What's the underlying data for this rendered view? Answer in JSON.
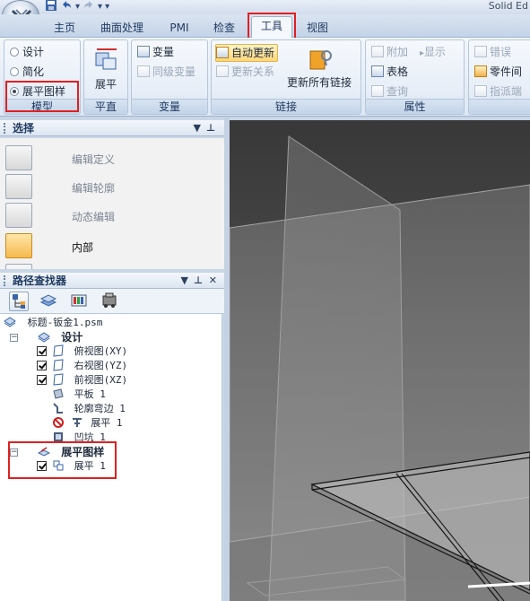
{
  "window": {
    "title_partial": "Solid Ed"
  },
  "tabs": [
    {
      "label": "主页"
    },
    {
      "label": "曲面处理"
    },
    {
      "label": "PMI"
    },
    {
      "label": "检查"
    },
    {
      "label": "工具"
    },
    {
      "label": "视图"
    }
  ],
  "ribbon": {
    "model": {
      "label": "模型",
      "options": [
        {
          "label": "设计"
        },
        {
          "label": "简化"
        },
        {
          "label": "展平图样"
        }
      ]
    },
    "plane": {
      "label": "平直",
      "button": "展平"
    },
    "variables": {
      "label": "变量",
      "items": [
        {
          "label": "变量"
        },
        {
          "label": "同级变量"
        }
      ]
    },
    "links": {
      "label": "链接",
      "auto_update": "自动更新",
      "update_relations": "更新关系",
      "update_all": "更新所有链接"
    },
    "properties": {
      "label": "属性",
      "attach": "附加",
      "show": "显示",
      "table": "表格",
      "query": "查询"
    },
    "errors": {
      "error": "错误",
      "part_gap": "零件间",
      "assign_end": "指派端"
    }
  },
  "select_panel": {
    "title": "选择",
    "items": [
      {
        "label": "编辑定义"
      },
      {
        "label": "编辑轮廓"
      },
      {
        "label": "动态编辑"
      },
      {
        "label": "内部"
      }
    ]
  },
  "pathfinder": {
    "title": "路径查找器",
    "tree": [
      {
        "text": "标题-钣金1.psm"
      },
      {
        "text": "设计"
      },
      {
        "text": "俯视图(XY)"
      },
      {
        "text": "右视图(YZ)"
      },
      {
        "text": "前视图(XZ)"
      },
      {
        "text": "平板 1"
      },
      {
        "text": "轮廓弯边 1"
      },
      {
        "text": "展平 1"
      },
      {
        "text": "凹坑 1"
      },
      {
        "text": "展平图样"
      },
      {
        "text": "展平 1"
      }
    ]
  },
  "colors": {
    "highlight_red": "#e02020",
    "viewport_bg": "#4a4a4a",
    "ribbon_bg": "#dde7f3"
  }
}
